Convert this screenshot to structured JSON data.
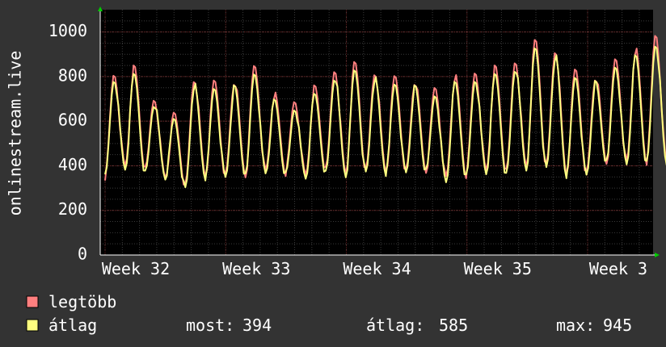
{
  "chart_data": {
    "type": "line",
    "title": "",
    "ylabel": "onlinestream.live",
    "xlabel": "",
    "ylim": [
      0,
      1100
    ],
    "y_ticks": [
      0,
      200,
      400,
      600,
      800,
      1000
    ],
    "x_tick_labels": [
      "Week 32",
      "Week 33",
      "Week 34",
      "Week 35",
      "Week 3"
    ],
    "grid": true,
    "legend_placement": "bottom-left",
    "days": 36,
    "series": [
      {
        "name": "legtöbb",
        "color": "#ff7f7f",
        "daily_peaks": [
          810,
          840,
          700,
          630,
          790,
          780,
          780,
          850,
          720,
          690,
          750,
          830,
          860,
          820,
          800,
          780,
          750,
          800,
          820,
          840,
          870,
          960,
          920,
          830,
          800,
          880,
          920,
          990,
          980,
          960
        ],
        "daily_troughs": [
          350,
          400,
          380,
          350,
          310,
          360,
          360,
          360,
          380,
          370,
          360,
          380,
          370,
          380,
          380,
          380,
          380,
          350,
          360,
          380,
          370,
          400,
          400,
          370,
          370,
          420,
          420,
          420,
          420,
          390
        ]
      },
      {
        "name": "átlag",
        "color": "#ffff80",
        "daily_peaks": [
          790,
          810,
          680,
          610,
          760,
          750,
          750,
          820,
          690,
          660,
          720,
          800,
          830,
          790,
          770,
          750,
          720,
          770,
          790,
          810,
          840,
          930,
          890,
          800,
          770,
          850,
          890,
          950,
          940,
          930
        ],
        "daily_troughs": [
          350,
          390,
          370,
          350,
          300,
          350,
          350,
          350,
          370,
          360,
          350,
          370,
          360,
          370,
          370,
          370,
          370,
          330,
          350,
          370,
          360,
          390,
          390,
          360,
          360,
          410,
          410,
          410,
          410,
          380
        ]
      }
    ],
    "stats": {
      "most_label": "most:",
      "most_value": 394,
      "atlag_label": "átlag:",
      "atlag_value": 585,
      "max_label": "max:",
      "max_value": 945
    },
    "colors": {
      "background": "#333333",
      "plot_background": "#000000",
      "grid": "#3a3a3a",
      "week_grid": "#5a1a1a",
      "axis_arrow": "#00cc00"
    }
  }
}
